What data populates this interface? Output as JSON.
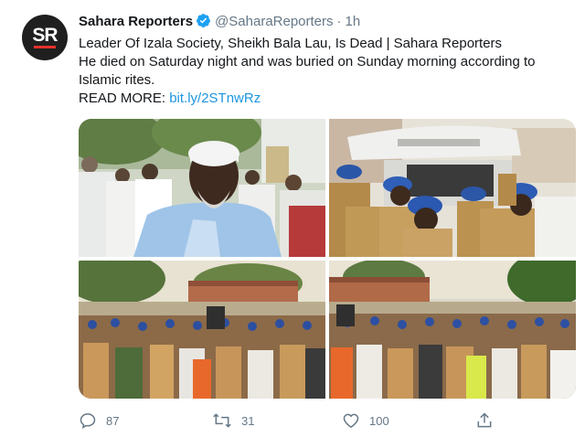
{
  "tweet": {
    "author_name": "Sahara Reporters",
    "handle": "@SaharaReporters",
    "separator": "·",
    "time": "1h",
    "avatar_text": "SR",
    "text_line1": "Leader Of Izala Society, Sheikh Bala Lau, Is Dead | Sahara Reporters",
    "text_line2": "He died on Saturday night and was buried on Sunday morning according to Islamic rites.",
    "read_more_label": "READ MORE:",
    "link_text": "bit.ly/2STnwRz"
  },
  "media": {
    "photos": [
      "sheikh-portrait-photo",
      "ambulance-officers-photo",
      "crowd-burial-photo-left",
      "crowd-burial-photo-right"
    ]
  },
  "actions": {
    "reply_count": "87",
    "retweet_count": "31",
    "like_count": "100"
  },
  "colors": {
    "link": "#1b95e0",
    "secondary_text": "#657786",
    "verified": "#1da1f2",
    "avatar_bg": "#1f1f1f",
    "avatar_accent": "#e4322b"
  },
  "icons": [
    "verified-badge-icon",
    "reply-icon",
    "retweet-icon",
    "like-icon",
    "share-icon"
  ]
}
